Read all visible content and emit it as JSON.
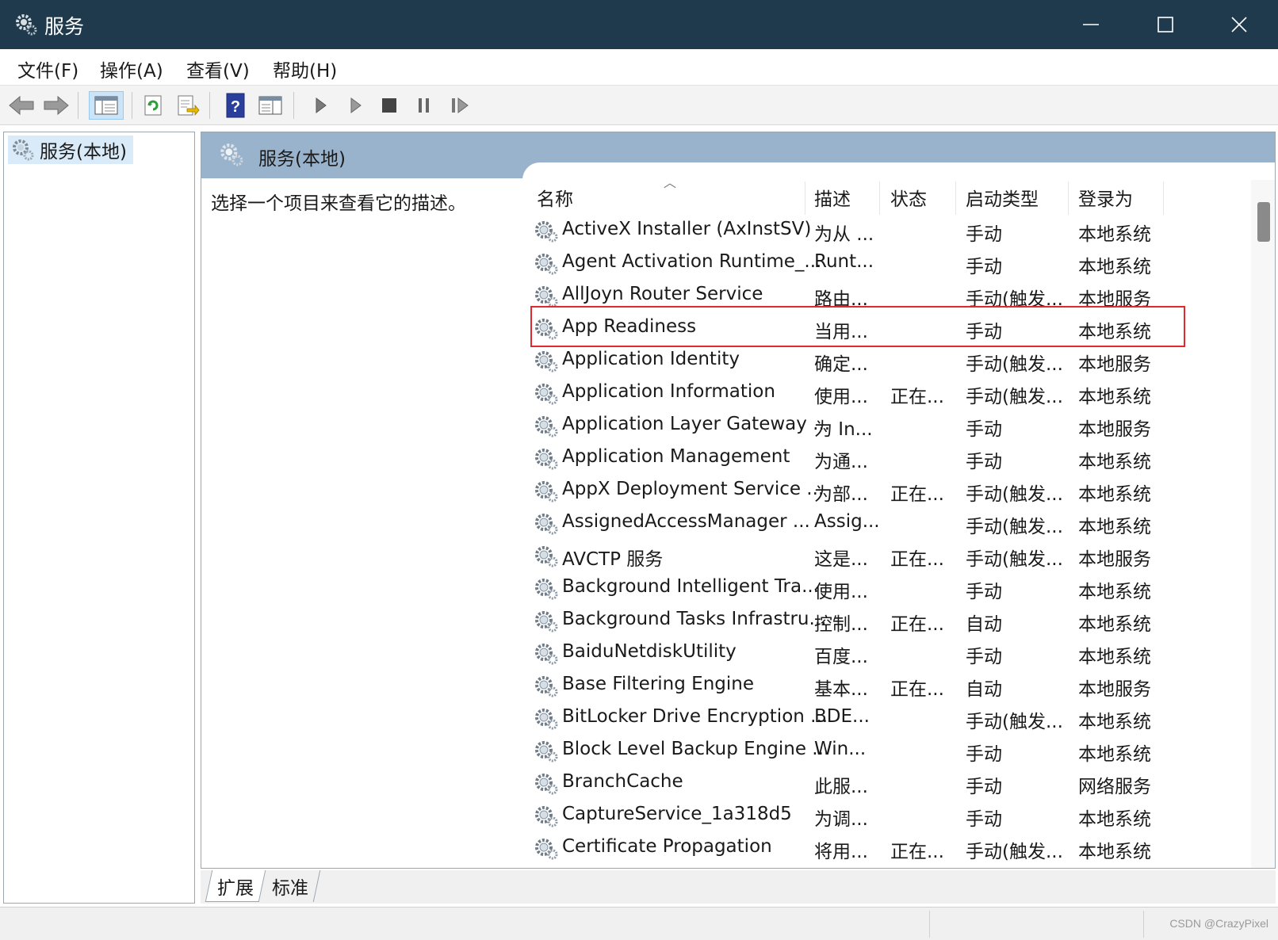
{
  "window": {
    "title": "服务",
    "app_icon": "gear-icon",
    "controls": [
      "minimize-icon",
      "maximize-icon",
      "close-icon"
    ]
  },
  "menu": [
    "文件(F)",
    "操作(A)",
    "查看(V)",
    "帮助(H)"
  ],
  "toolbar": {
    "buttons": [
      "back-icon",
      "forward-icon",
      "show-hide-tree-icon",
      "refresh-icon",
      "export-list-icon",
      "help-icon",
      "properties-icon",
      "start-service-icon",
      "start-service-params-icon",
      "stop-service-icon",
      "pause-service-icon",
      "resume-service-icon"
    ]
  },
  "tree": {
    "root_label": "服务(本地)"
  },
  "pane": {
    "header_title": "服务(本地)",
    "description": "选择一个项目来查看它的描述。"
  },
  "columns": {
    "name": "名称",
    "desc": "描述",
    "status": "状态",
    "startup": "启动类型",
    "logon": "登录为"
  },
  "services": [
    {
      "name": "ActiveX Installer (AxInstSV)",
      "desc": "为从 ...",
      "status": "",
      "startup": "手动",
      "logon": "本地系统"
    },
    {
      "name": "Agent Activation Runtime_...",
      "desc": "Runt...",
      "status": "",
      "startup": "手动",
      "logon": "本地系统"
    },
    {
      "name": "AllJoyn Router Service",
      "desc": "路由...",
      "status": "",
      "startup": "手动(触发...",
      "logon": "本地服务"
    },
    {
      "name": "App Readiness",
      "desc": "当用...",
      "status": "",
      "startup": "手动",
      "logon": "本地系统"
    },
    {
      "name": "Application Identity",
      "desc": "确定...",
      "status": "",
      "startup": "手动(触发...",
      "logon": "本地服务"
    },
    {
      "name": "Application Information",
      "desc": "使用...",
      "status": "正在...",
      "startup": "手动(触发...",
      "logon": "本地系统"
    },
    {
      "name": "Application Layer Gateway ...",
      "desc": "为 In...",
      "status": "",
      "startup": "手动",
      "logon": "本地服务"
    },
    {
      "name": "Application Management",
      "desc": "为通...",
      "status": "",
      "startup": "手动",
      "logon": "本地系统"
    },
    {
      "name": "AppX Deployment Service ...",
      "desc": "为部...",
      "status": "正在...",
      "startup": "手动(触发...",
      "logon": "本地系统"
    },
    {
      "name": "AssignedAccessManager ...",
      "desc": "Assig...",
      "status": "",
      "startup": "手动(触发...",
      "logon": "本地系统"
    },
    {
      "name": "AVCTP 服务",
      "desc": "这是...",
      "status": "正在...",
      "startup": "手动(触发...",
      "logon": "本地服务"
    },
    {
      "name": "Background Intelligent Tra...",
      "desc": "使用...",
      "status": "",
      "startup": "手动",
      "logon": "本地系统"
    },
    {
      "name": "Background Tasks Infrastru...",
      "desc": "控制...",
      "status": "正在...",
      "startup": "自动",
      "logon": "本地系统"
    },
    {
      "name": "BaiduNetdiskUtility",
      "desc": "百度...",
      "status": "",
      "startup": "手动",
      "logon": "本地系统"
    },
    {
      "name": "Base Filtering Engine",
      "desc": "基本...",
      "status": "正在...",
      "startup": "自动",
      "logon": "本地服务"
    },
    {
      "name": "BitLocker Drive Encryption ...",
      "desc": "BDE...",
      "status": "",
      "startup": "手动(触发...",
      "logon": "本地系统"
    },
    {
      "name": "Block Level Backup Engine ...",
      "desc": "Win...",
      "status": "",
      "startup": "手动",
      "logon": "本地系统"
    },
    {
      "name": "BranchCache",
      "desc": "此服...",
      "status": "",
      "startup": "手动",
      "logon": "网络服务"
    },
    {
      "name": "CaptureService_1a318d5",
      "desc": "为调...",
      "status": "",
      "startup": "手动",
      "logon": "本地系统"
    },
    {
      "name": "Certificate Propagation",
      "desc": "将用...",
      "status": "正在...",
      "startup": "手动(触发...",
      "logon": "本地系统"
    }
  ],
  "highlight_color": "#e0282e",
  "tabs": [
    "扩展",
    "标准"
  ],
  "watermark": "CSDN @CrazyPixel"
}
